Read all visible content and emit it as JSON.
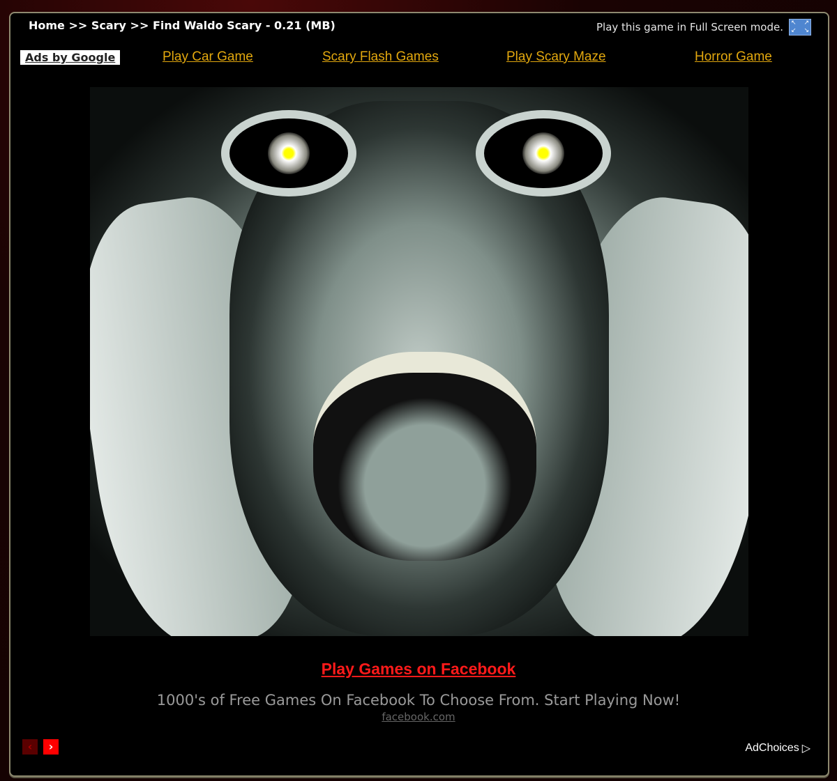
{
  "header": {
    "breadcrumb": "Home >> Scary >> Find Waldo Scary - 0.21 (MB)",
    "fullscreen_text": "Play this game in Full Screen mode."
  },
  "adlinks": {
    "ads_by_google": "Ads by Google",
    "links": [
      "Play Car Game",
      "Scary Flash Games",
      "Play Scary Maze",
      "Horror Game"
    ]
  },
  "ad": {
    "title": "Play Games on Facebook",
    "description": "1000's of Free Games On Facebook To Choose From. Start Playing Now!",
    "url": "facebook.com",
    "prev": "‹",
    "next": "›",
    "adchoices": "AdChoices"
  },
  "colors": {
    "link": "#e3a80e",
    "ad_title": "#ff1a1a",
    "panel_border": "#8e8a70"
  }
}
